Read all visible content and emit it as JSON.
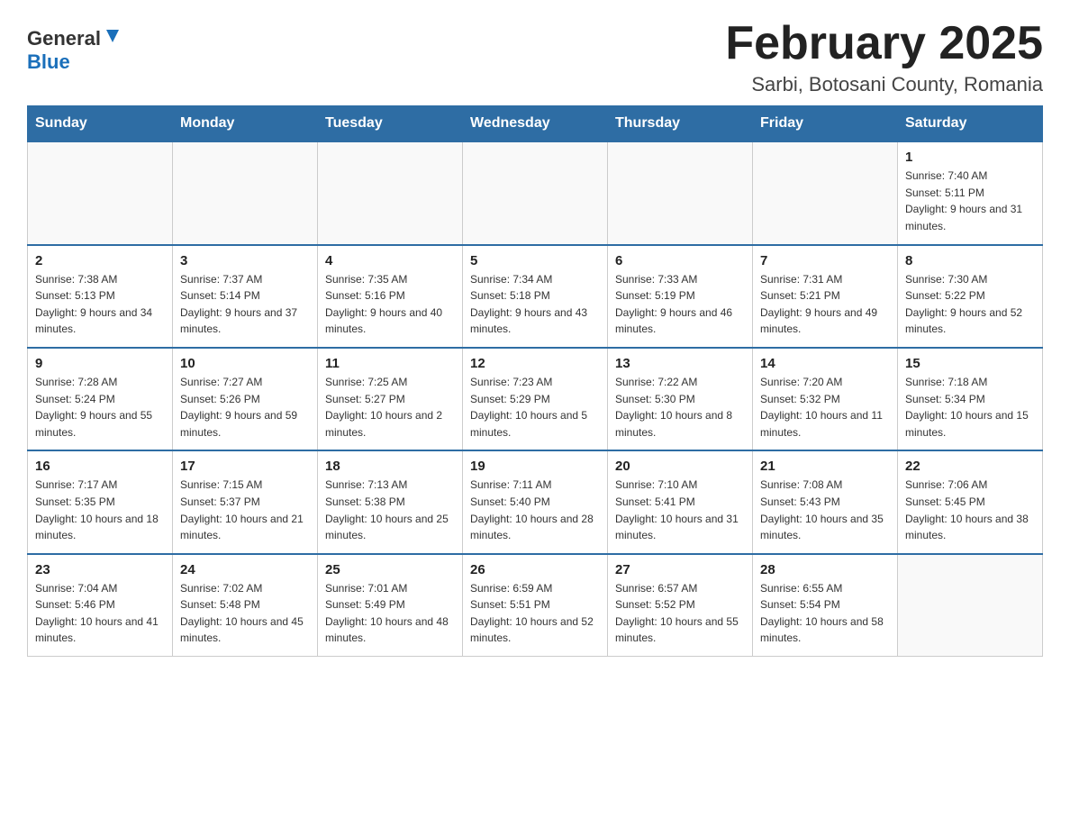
{
  "header": {
    "logo_general": "General",
    "logo_blue": "Blue",
    "title": "February 2025",
    "subtitle": "Sarbi, Botosani County, Romania"
  },
  "days_of_week": [
    "Sunday",
    "Monday",
    "Tuesday",
    "Wednesday",
    "Thursday",
    "Friday",
    "Saturday"
  ],
  "weeks": [
    [
      {
        "num": "",
        "info": ""
      },
      {
        "num": "",
        "info": ""
      },
      {
        "num": "",
        "info": ""
      },
      {
        "num": "",
        "info": ""
      },
      {
        "num": "",
        "info": ""
      },
      {
        "num": "",
        "info": ""
      },
      {
        "num": "1",
        "info": "Sunrise: 7:40 AM\nSunset: 5:11 PM\nDaylight: 9 hours and 31 minutes."
      }
    ],
    [
      {
        "num": "2",
        "info": "Sunrise: 7:38 AM\nSunset: 5:13 PM\nDaylight: 9 hours and 34 minutes."
      },
      {
        "num": "3",
        "info": "Sunrise: 7:37 AM\nSunset: 5:14 PM\nDaylight: 9 hours and 37 minutes."
      },
      {
        "num": "4",
        "info": "Sunrise: 7:35 AM\nSunset: 5:16 PM\nDaylight: 9 hours and 40 minutes."
      },
      {
        "num": "5",
        "info": "Sunrise: 7:34 AM\nSunset: 5:18 PM\nDaylight: 9 hours and 43 minutes."
      },
      {
        "num": "6",
        "info": "Sunrise: 7:33 AM\nSunset: 5:19 PM\nDaylight: 9 hours and 46 minutes."
      },
      {
        "num": "7",
        "info": "Sunrise: 7:31 AM\nSunset: 5:21 PM\nDaylight: 9 hours and 49 minutes."
      },
      {
        "num": "8",
        "info": "Sunrise: 7:30 AM\nSunset: 5:22 PM\nDaylight: 9 hours and 52 minutes."
      }
    ],
    [
      {
        "num": "9",
        "info": "Sunrise: 7:28 AM\nSunset: 5:24 PM\nDaylight: 9 hours and 55 minutes."
      },
      {
        "num": "10",
        "info": "Sunrise: 7:27 AM\nSunset: 5:26 PM\nDaylight: 9 hours and 59 minutes."
      },
      {
        "num": "11",
        "info": "Sunrise: 7:25 AM\nSunset: 5:27 PM\nDaylight: 10 hours and 2 minutes."
      },
      {
        "num": "12",
        "info": "Sunrise: 7:23 AM\nSunset: 5:29 PM\nDaylight: 10 hours and 5 minutes."
      },
      {
        "num": "13",
        "info": "Sunrise: 7:22 AM\nSunset: 5:30 PM\nDaylight: 10 hours and 8 minutes."
      },
      {
        "num": "14",
        "info": "Sunrise: 7:20 AM\nSunset: 5:32 PM\nDaylight: 10 hours and 11 minutes."
      },
      {
        "num": "15",
        "info": "Sunrise: 7:18 AM\nSunset: 5:34 PM\nDaylight: 10 hours and 15 minutes."
      }
    ],
    [
      {
        "num": "16",
        "info": "Sunrise: 7:17 AM\nSunset: 5:35 PM\nDaylight: 10 hours and 18 minutes."
      },
      {
        "num": "17",
        "info": "Sunrise: 7:15 AM\nSunset: 5:37 PM\nDaylight: 10 hours and 21 minutes."
      },
      {
        "num": "18",
        "info": "Sunrise: 7:13 AM\nSunset: 5:38 PM\nDaylight: 10 hours and 25 minutes."
      },
      {
        "num": "19",
        "info": "Sunrise: 7:11 AM\nSunset: 5:40 PM\nDaylight: 10 hours and 28 minutes."
      },
      {
        "num": "20",
        "info": "Sunrise: 7:10 AM\nSunset: 5:41 PM\nDaylight: 10 hours and 31 minutes."
      },
      {
        "num": "21",
        "info": "Sunrise: 7:08 AM\nSunset: 5:43 PM\nDaylight: 10 hours and 35 minutes."
      },
      {
        "num": "22",
        "info": "Sunrise: 7:06 AM\nSunset: 5:45 PM\nDaylight: 10 hours and 38 minutes."
      }
    ],
    [
      {
        "num": "23",
        "info": "Sunrise: 7:04 AM\nSunset: 5:46 PM\nDaylight: 10 hours and 41 minutes."
      },
      {
        "num": "24",
        "info": "Sunrise: 7:02 AM\nSunset: 5:48 PM\nDaylight: 10 hours and 45 minutes."
      },
      {
        "num": "25",
        "info": "Sunrise: 7:01 AM\nSunset: 5:49 PM\nDaylight: 10 hours and 48 minutes."
      },
      {
        "num": "26",
        "info": "Sunrise: 6:59 AM\nSunset: 5:51 PM\nDaylight: 10 hours and 52 minutes."
      },
      {
        "num": "27",
        "info": "Sunrise: 6:57 AM\nSunset: 5:52 PM\nDaylight: 10 hours and 55 minutes."
      },
      {
        "num": "28",
        "info": "Sunrise: 6:55 AM\nSunset: 5:54 PM\nDaylight: 10 hours and 58 minutes."
      },
      {
        "num": "",
        "info": ""
      }
    ]
  ]
}
